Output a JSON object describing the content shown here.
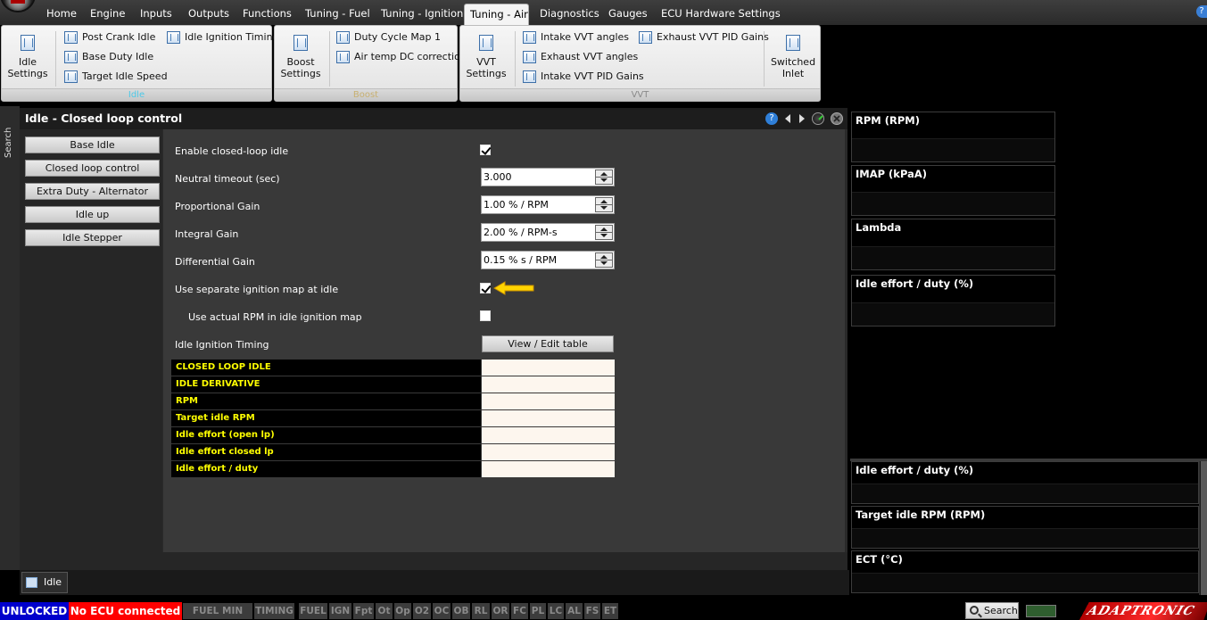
{
  "tabs": [
    "Home",
    "Engine",
    "Inputs",
    "Outputs",
    "Functions",
    "Tuning - Fuel",
    "Tuning - Ignition",
    "Tuning - Air",
    "Diagnostics",
    "Gauges",
    "ECU Hardware Settings"
  ],
  "active_tab": "Tuning - Air",
  "ribbon": {
    "idle": {
      "label": "Idle",
      "settings": "Idle Settings",
      "post_crank": "Post Crank Idle",
      "base_duty": "Base Duty Idle",
      "target_idle_speed": "Target Idle Speed",
      "idle_ignition_timing": "Idle Ignition Timing"
    },
    "boost": {
      "label": "Boost",
      "settings": "Boost Settings",
      "duty_cycle_map": "Duty Cycle Map 1",
      "air_temp_dc": "Air temp DC correction"
    },
    "vvt": {
      "label": "VVT",
      "settings": "VVT Settings",
      "intake_angles": "Intake VVT angles",
      "exhaust_angles": "Exhaust VVT angles",
      "intake_pid": "Intake VVT PID Gains",
      "exhaust_pid": "Exhaust VVT PID Gains",
      "switched_inlet": "Switched Inlet"
    }
  },
  "search_strip": "Search",
  "panel": {
    "title": "Idle - Closed loop control",
    "nav": [
      "Base Idle",
      "Closed loop control",
      "Extra Duty - Alternator",
      "Idle up",
      "Idle Stepper"
    ],
    "fields": {
      "enable_cl": {
        "label": "Enable closed-loop idle",
        "checked": true
      },
      "neutral_timeout": {
        "label": "Neutral timeout (sec)",
        "value": "3.000"
      },
      "p_gain": {
        "label": "Proportional Gain",
        "value": "1.00 % / RPM"
      },
      "i_gain": {
        "label": "Integral Gain",
        "value": "2.00 % / RPM-s"
      },
      "d_gain": {
        "label": "Differential Gain",
        "value": "0.15 % s / RPM"
      },
      "sep_ign": {
        "label": "Use separate ignition map at idle",
        "checked": true
      },
      "actual_rpm": {
        "label": "Use actual RPM in idle ignition map",
        "checked": false
      },
      "ign_timing": {
        "label": "Idle Ignition Timing",
        "button": "View / Edit table"
      }
    },
    "live_rows": [
      "CLOSED LOOP IDLE",
      "IDLE DERIVATIVE",
      "RPM",
      "Target idle RPM",
      "Idle effort (open lp)",
      "Idle effort closed lp",
      "Idle effort / duty"
    ]
  },
  "bottom_tab": "Idle",
  "gauges_top": [
    "RPM (RPM)",
    "IMAP  (kPaA)",
    "Lambda",
    "Idle effort / duty (%)"
  ],
  "gauges_bottom": [
    "Idle effort / duty (%)",
    "Target idle RPM (RPM)",
    "ECT (°C)"
  ],
  "status": {
    "unlocked": "UNLOCKED",
    "ecu": "No ECU connected",
    "indicators": [
      "FUEL MIN PW",
      "TIMING",
      "FUEL",
      "IGN",
      "Fpt",
      "Ot",
      "Op",
      "O2",
      "OC",
      "OB",
      "RL",
      "OR",
      "FC",
      "PL",
      "LC",
      "AL",
      "FS",
      "ET"
    ],
    "search": "Search",
    "brand": "ADAPTRONIC"
  },
  "colors": {
    "accent_label": "#4cc9e8",
    "unlocked_bg": "#0000cc",
    "ecu_bg": "#ff0000",
    "live_text": "#ffff00",
    "arrow": "#ffd400"
  }
}
